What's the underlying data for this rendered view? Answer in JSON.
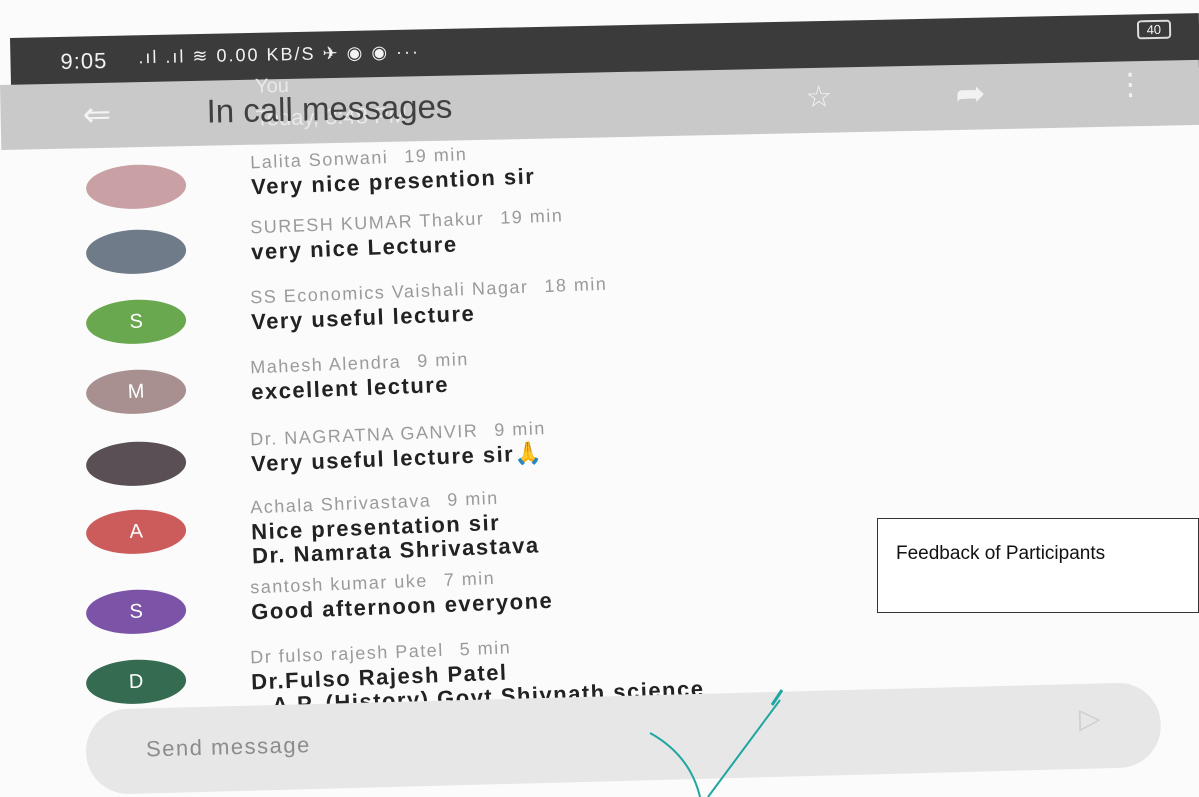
{
  "status_bar": {
    "time": "9:05",
    "icons": ".ıl .ıl ≋ 0.00 KB/S ✈ ◉ ◉ ···",
    "battery": "40"
  },
  "app_bar": {
    "back_icon": "back-arrow-icon",
    "title": "In call messages",
    "ghost_subtitle": "You",
    "ghost_time": "Today, 3:48 PM",
    "star_icon": "star-icon",
    "share_icon": "share-arrow-icon",
    "more_icon": "more-vert-icon"
  },
  "messages": [
    {
      "name": "Lalita Sonwani",
      "time": "19 min",
      "text": "Very  nice presention sir",
      "text2": "",
      "avatar_initial": "",
      "avatar_color": "#c9a0a4"
    },
    {
      "name": "SURESH KUMAR Thakur",
      "time": "19 min",
      "text": "very nice Lecture",
      "text2": "",
      "avatar_initial": "",
      "avatar_color": "#6f7b88"
    },
    {
      "name": "SS Economics Vaishali Nagar",
      "time": "18 min",
      "text": "Very useful lecture",
      "text2": "",
      "avatar_initial": "S",
      "avatar_color": "#6aa84f"
    },
    {
      "name": "Mahesh Alendra",
      "time": "9 min",
      "text": "excellent lecture",
      "text2": "",
      "avatar_initial": "M",
      "avatar_color": "#a89090"
    },
    {
      "name": "Dr. NAGRATNA GANVIR",
      "time": "9 min",
      "text": "Very useful lecture sir🙏",
      "text2": "",
      "avatar_initial": "",
      "avatar_color": "#5a4f55"
    },
    {
      "name": "Achala Shrivastava",
      "time": "9 min",
      "text": "Nice presentation sir",
      "text2": "Dr. Namrata Shrivastava",
      "avatar_initial": "A",
      "avatar_color": "#cc5c5c"
    },
    {
      "name": "santosh kumar uke",
      "time": "7 min",
      "text": "Good  afternoon  everyone",
      "text2": "",
      "avatar_initial": "S",
      "avatar_color": "#7b54a8"
    },
    {
      "name": "Dr fulso rajesh Patel",
      "time": "5 min",
      "text": "Dr.Fulso Rajesh Patel",
      "text2": "A.P. (History),Govt.Shivnath science",
      "avatar_initial": "D",
      "avatar_color": "#356b50"
    }
  ],
  "composer": {
    "placeholder": "Send message",
    "send_icon": "send-icon"
  },
  "annotation": {
    "label": "Feedback of Participants"
  }
}
